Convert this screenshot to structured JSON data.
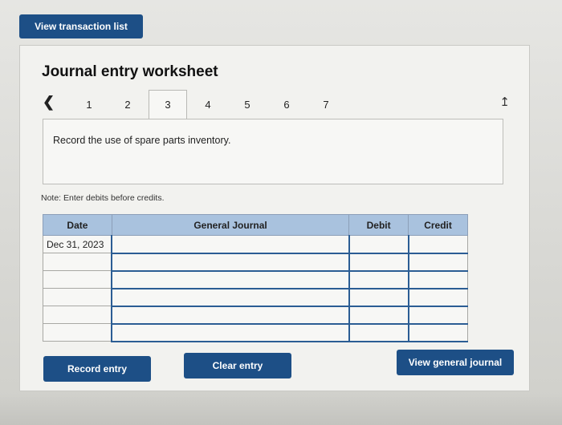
{
  "header": {
    "view_transaction_list": "View transaction list"
  },
  "worksheet": {
    "title": "Journal entry worksheet",
    "tabs": [
      "1",
      "2",
      "3",
      "4",
      "5",
      "6",
      "7"
    ],
    "active_tab": "3",
    "prev_icon": "chevron-left-icon",
    "corner_icon": "cursor-icon",
    "description": "Record the use of spare parts inventory.",
    "note": "Note: Enter debits before credits."
  },
  "table": {
    "headers": {
      "date": "Date",
      "journal": "General Journal",
      "debit": "Debit",
      "credit": "Credit"
    },
    "rows": [
      {
        "date": "Dec 31, 2023",
        "account": "",
        "debit": "",
        "credit": ""
      },
      {
        "date": "",
        "account": "",
        "debit": "",
        "credit": ""
      },
      {
        "date": "",
        "account": "",
        "debit": "",
        "credit": ""
      },
      {
        "date": "",
        "account": "",
        "debit": "",
        "credit": ""
      },
      {
        "date": "",
        "account": "",
        "debit": "",
        "credit": ""
      },
      {
        "date": "",
        "account": "",
        "debit": "",
        "credit": ""
      }
    ]
  },
  "buttons": {
    "record": "Record entry",
    "clear": "Clear entry",
    "view_journal": "View general journal"
  },
  "colors": {
    "button_blue": "#1d4f86",
    "header_blue": "#a9c2de",
    "cell_border_blue": "#2b5d94"
  }
}
